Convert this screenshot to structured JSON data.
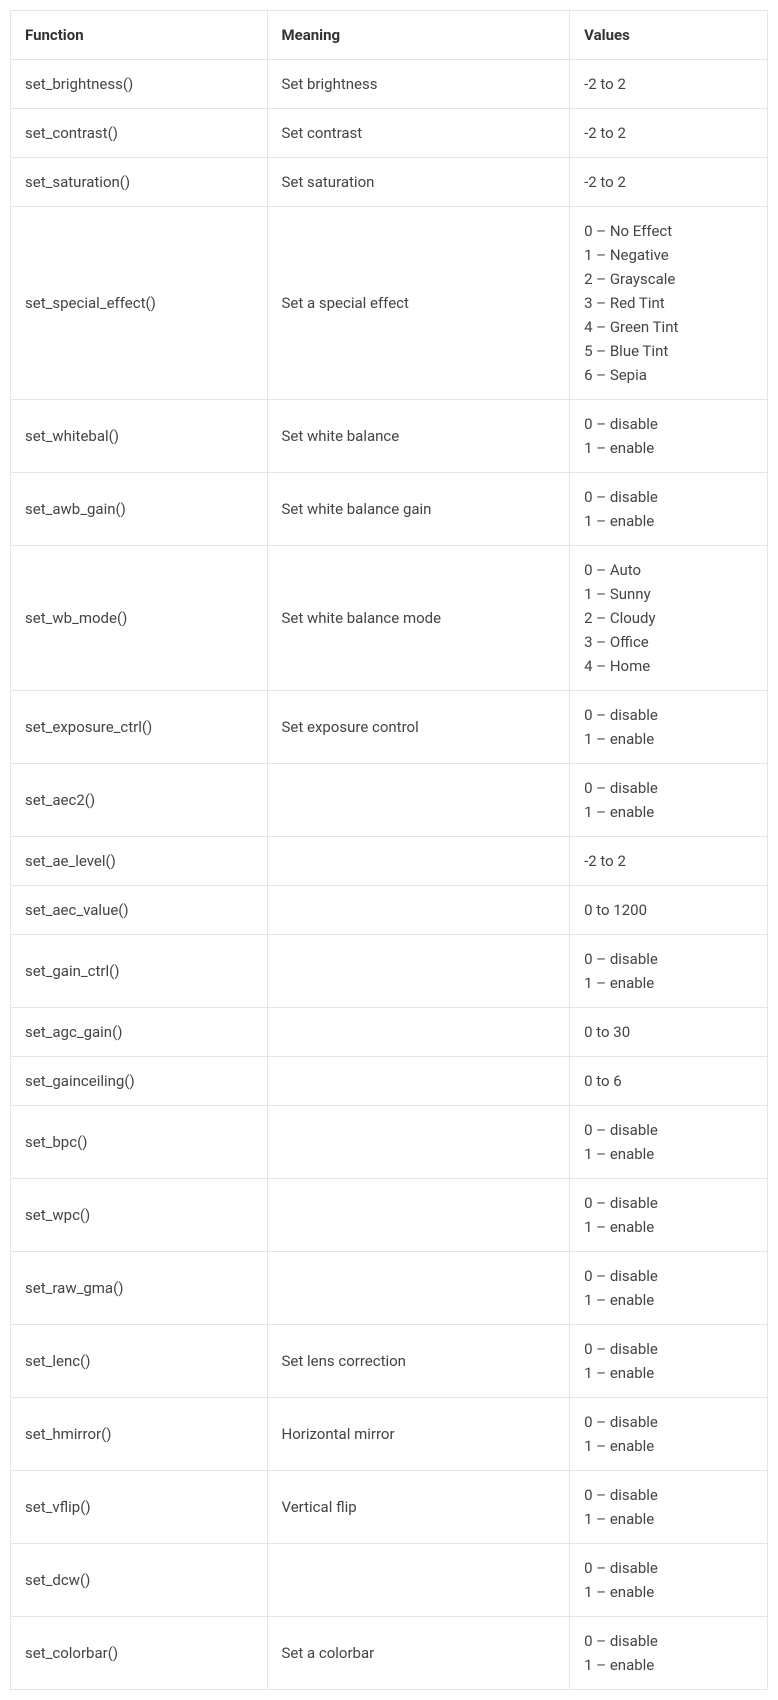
{
  "headers": [
    "Function",
    "Meaning",
    "Values"
  ],
  "rows": [
    {
      "fn": "set_brightness()",
      "meaning": "Set brightness",
      "values": "-2 to 2"
    },
    {
      "fn": "set_contrast()",
      "meaning": "Set contrast",
      "values": "-2 to 2"
    },
    {
      "fn": "set_saturation()",
      "meaning": "Set saturation",
      "values": "-2 to 2"
    },
    {
      "fn": "set_special_effect()",
      "meaning": "Set a special effect",
      "values": "0 – No Effect\n1 – Negative\n2 – Grayscale\n3 – Red Tint\n4 – Green Tint\n5 – Blue Tint\n6 – Sepia"
    },
    {
      "fn": "set_whitebal()",
      "meaning": "Set white balance",
      "values": "0 – disable\n1 – enable"
    },
    {
      "fn": "set_awb_gain()",
      "meaning": "Set white balance gain",
      "values": "0 – disable\n1 – enable"
    },
    {
      "fn": "set_wb_mode()",
      "meaning": "Set white balance mode",
      "values": "0 – Auto\n1 – Sunny\n2 – Cloudy\n3 – Office\n4 – Home"
    },
    {
      "fn": "set_exposure_ctrl()",
      "meaning": "Set exposure control",
      "values": "0 – disable\n1 – enable"
    },
    {
      "fn": "set_aec2()",
      "meaning": "",
      "values": "0 – disable\n1 – enable"
    },
    {
      "fn": "set_ae_level()",
      "meaning": "",
      "values": "-2 to 2"
    },
    {
      "fn": "set_aec_value()",
      "meaning": "",
      "values": "0 to 1200"
    },
    {
      "fn": "set_gain_ctrl()",
      "meaning": "",
      "values": "0 – disable\n1 – enable"
    },
    {
      "fn": "set_agc_gain()",
      "meaning": "",
      "values": "0 to 30"
    },
    {
      "fn": "set_gainceiling()",
      "meaning": "",
      "values": "0 to 6"
    },
    {
      "fn": "set_bpc()",
      "meaning": "",
      "values": "0 – disable\n1 – enable"
    },
    {
      "fn": "set_wpc()",
      "meaning": "",
      "values": "0 – disable\n1 – enable"
    },
    {
      "fn": "set_raw_gma()",
      "meaning": "",
      "values": "0 – disable\n1 – enable"
    },
    {
      "fn": "set_lenc()",
      "meaning": "Set lens correction",
      "values": "0 – disable\n1 – enable"
    },
    {
      "fn": "set_hmirror()",
      "meaning": "Horizontal mirror",
      "values": "0 – disable\n1 – enable"
    },
    {
      "fn": "set_vflip()",
      "meaning": "Vertical flip",
      "values": "0 – disable\n1 – enable"
    },
    {
      "fn": "set_dcw()",
      "meaning": "",
      "values": "0 – disable\n1 – enable"
    },
    {
      "fn": "set_colorbar()",
      "meaning": "Set a colorbar",
      "values": "0 – disable\n1 – enable"
    }
  ]
}
